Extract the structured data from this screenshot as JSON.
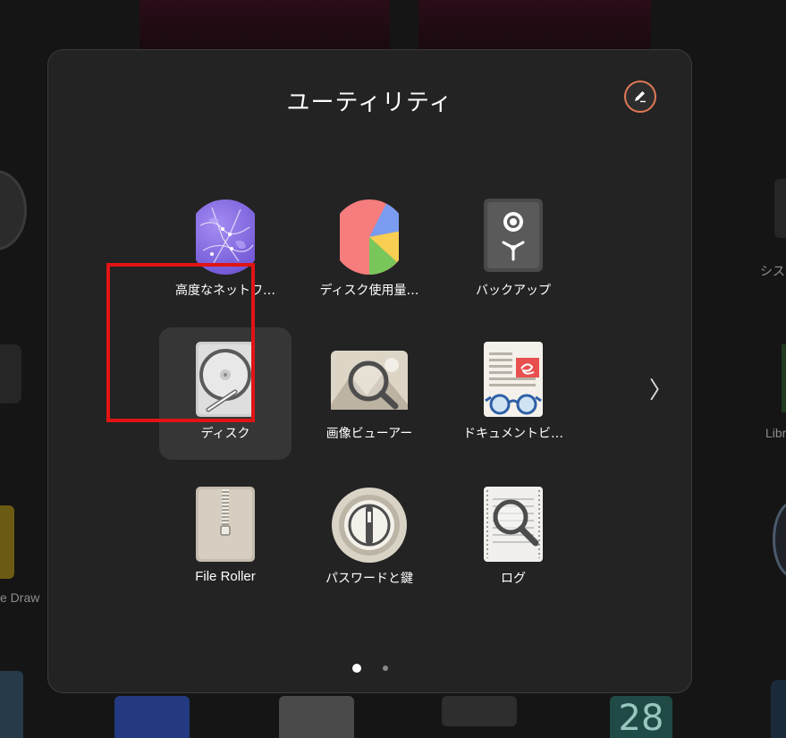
{
  "folder": {
    "title": "ユーティリティ",
    "edit_icon": "pencil-icon",
    "next_page_icon": "chevron-right-icon",
    "pages": 2,
    "current_page": 1
  },
  "apps": [
    {
      "label": "高度なネットワ…",
      "icon": "network-globe-icon"
    },
    {
      "label": "ディスク使用量…",
      "icon": "disk-usage-pie-icon"
    },
    {
      "label": "バックアップ",
      "icon": "backup-safe-icon"
    },
    {
      "label": "ディスク",
      "icon": "hard-disk-icon",
      "selected": true
    },
    {
      "label": "画像ビューアー",
      "icon": "image-viewer-icon"
    },
    {
      "label": "ドキュメントビ…",
      "icon": "document-viewer-icon"
    },
    {
      "label": "File Roller",
      "icon": "archive-zipper-icon"
    },
    {
      "label": "パスワードと鍵",
      "icon": "passwords-keys-icon"
    },
    {
      "label": "ログ",
      "icon": "logs-icon"
    }
  ],
  "background": {
    "left_label": "e Draw",
    "right_label_1": "シス",
    "right_label_2": "Libr",
    "bottom_number": "28"
  },
  "colors": {
    "folder_bg": "#232323",
    "selection_bg": "#363636",
    "highlight_red": "#e11414",
    "edit_ring": "#e27a56"
  }
}
